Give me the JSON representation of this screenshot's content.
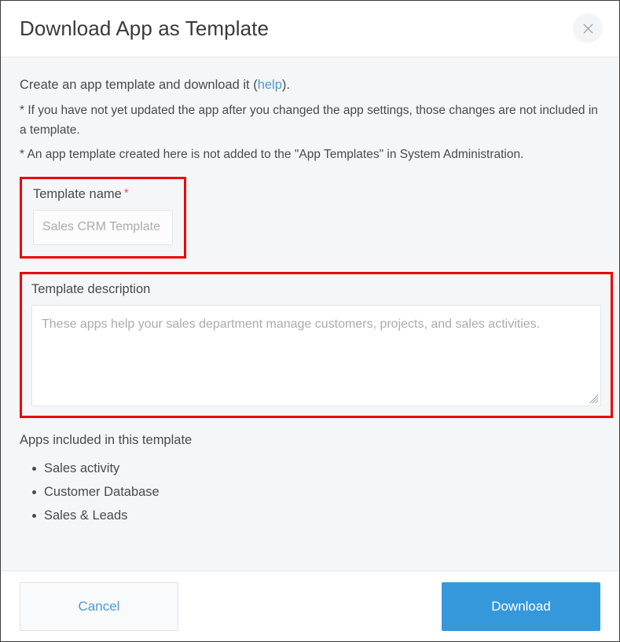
{
  "dialog": {
    "title": "Download App as Template",
    "close_icon": "close-icon"
  },
  "body": {
    "intro_prefix": "Create an app template and download it (",
    "intro_link": "help",
    "intro_suffix": ").",
    "note_1": "* If you have not yet updated the app after you changed the app settings, those changes are not included in a template.",
    "note_2": "* An app template created here is not added to the \"App Templates\" in System Administration."
  },
  "template_name": {
    "label": "Template name",
    "required_marker": "*",
    "value": "",
    "placeholder": "Sales CRM Template"
  },
  "template_description": {
    "label": "Template description",
    "value": "",
    "placeholder": "These apps help your sales department manage customers, projects, and sales activities."
  },
  "apps": {
    "title": "Apps included in this template",
    "items": [
      {
        "name": "Sales activity"
      },
      {
        "name": "Customer Database"
      },
      {
        "name": "Sales & Leads"
      }
    ]
  },
  "footer": {
    "cancel_label": "Cancel",
    "download_label": "Download"
  },
  "colors": {
    "accent_blue": "#3498db",
    "link_blue": "#4a9bd4",
    "highlight_red": "#ee0000",
    "required_red": "#e8505b",
    "body_background": "#f5f6f8",
    "panel_white": "#ffffff"
  }
}
